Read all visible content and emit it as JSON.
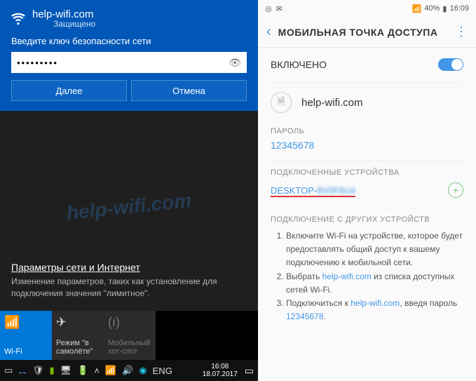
{
  "windows": {
    "network_name": "help-wifi.com",
    "status": "Защищено",
    "prompt": "Введите ключ безопасности сети",
    "password_value": "•••••••••",
    "next_btn": "Далее",
    "cancel_btn": "Отмена",
    "settings_link": "Параметры сети и Интернет",
    "settings_desc": "Изменение параметров, таких как установление для подключения значения \"лимитное\".",
    "tiles": {
      "wifi": "Wi-Fi",
      "airplane": "Режим \"в самолёте\"",
      "hotspot": "Мобильный хот-спот"
    },
    "taskbar": {
      "lang": "ENG",
      "time": "16:08",
      "date": "18.07.2017"
    },
    "watermark": "help-wifi.com"
  },
  "android": {
    "status": {
      "battery": "40%",
      "time": "16:09"
    },
    "header": "МОБИЛЬНАЯ ТОЧКА ДОСТУПА",
    "enabled_label": "ВКЛЮЧЕНО",
    "net_name": "help-wifi.com",
    "password_label": "ПАРОЛЬ",
    "password_value": "12345678",
    "connected_label": "ПОДКЛЮЧЕННЫЕ УСТРОЙСТВА",
    "device_name": "DESKTOP-",
    "device_blur": "8V0F8U4",
    "other_label": "ПОДКЛЮЧЕНИЕ С ДРУГИХ УСТРОЙСТВ",
    "instructions": {
      "i1a": "Включите Wi-Fi на устройстве, которое будет предоставлять общий доступ к вашему подключению к мобильной сети.",
      "i2a": "Выбрать ",
      "i2b": "help-wifi.com",
      "i2c": " из списка доступных сетей Wi-Fi.",
      "i3a": "Подключиться к ",
      "i3b": "help-wifi.com",
      "i3c": ", введя пароль ",
      "i3d": "12345678",
      "i3e": "."
    }
  }
}
